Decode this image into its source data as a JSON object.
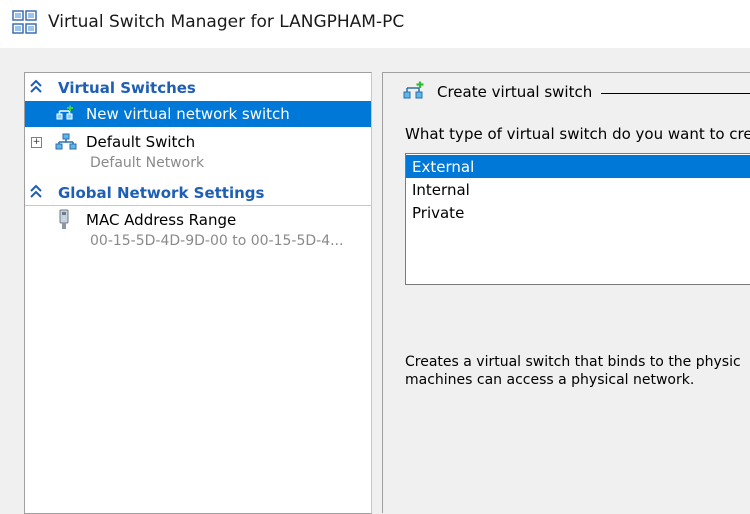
{
  "window": {
    "title": "Virtual Switch Manager for LANGPHAM-PC"
  },
  "left_pane": {
    "sections": [
      {
        "label": "Virtual Switches",
        "items": [
          {
            "label": "New virtual network switch",
            "selected": true
          },
          {
            "label": "Default Switch",
            "subtext": "Default Network",
            "expandable": true
          }
        ]
      },
      {
        "label": "Global Network Settings",
        "items": [
          {
            "label": "MAC Address Range",
            "subtext": "00-15-5D-4D-9D-00 to 00-15-5D-4..."
          }
        ]
      }
    ]
  },
  "right_pane": {
    "group_title": "Create virtual switch",
    "question": "What type of virtual switch do you want to crea",
    "switch_types": [
      {
        "label": "External",
        "selected": true
      },
      {
        "label": "Internal",
        "selected": false
      },
      {
        "label": "Private",
        "selected": false
      }
    ],
    "description_line1": "Creates a virtual switch that binds to the physic",
    "description_line2": "machines can access a physical network."
  },
  "colors": {
    "selection": "#0078d7",
    "section_header": "#1e5fb3"
  },
  "icons": {
    "app": "virtual-switch-manager-icon",
    "new_switch": "new-network-switch-icon",
    "default_switch": "network-switch-icon",
    "mac_range": "network-adapter-icon",
    "section_collapse": "double-chevron-up-icon",
    "expander": "plus-box-icon"
  }
}
